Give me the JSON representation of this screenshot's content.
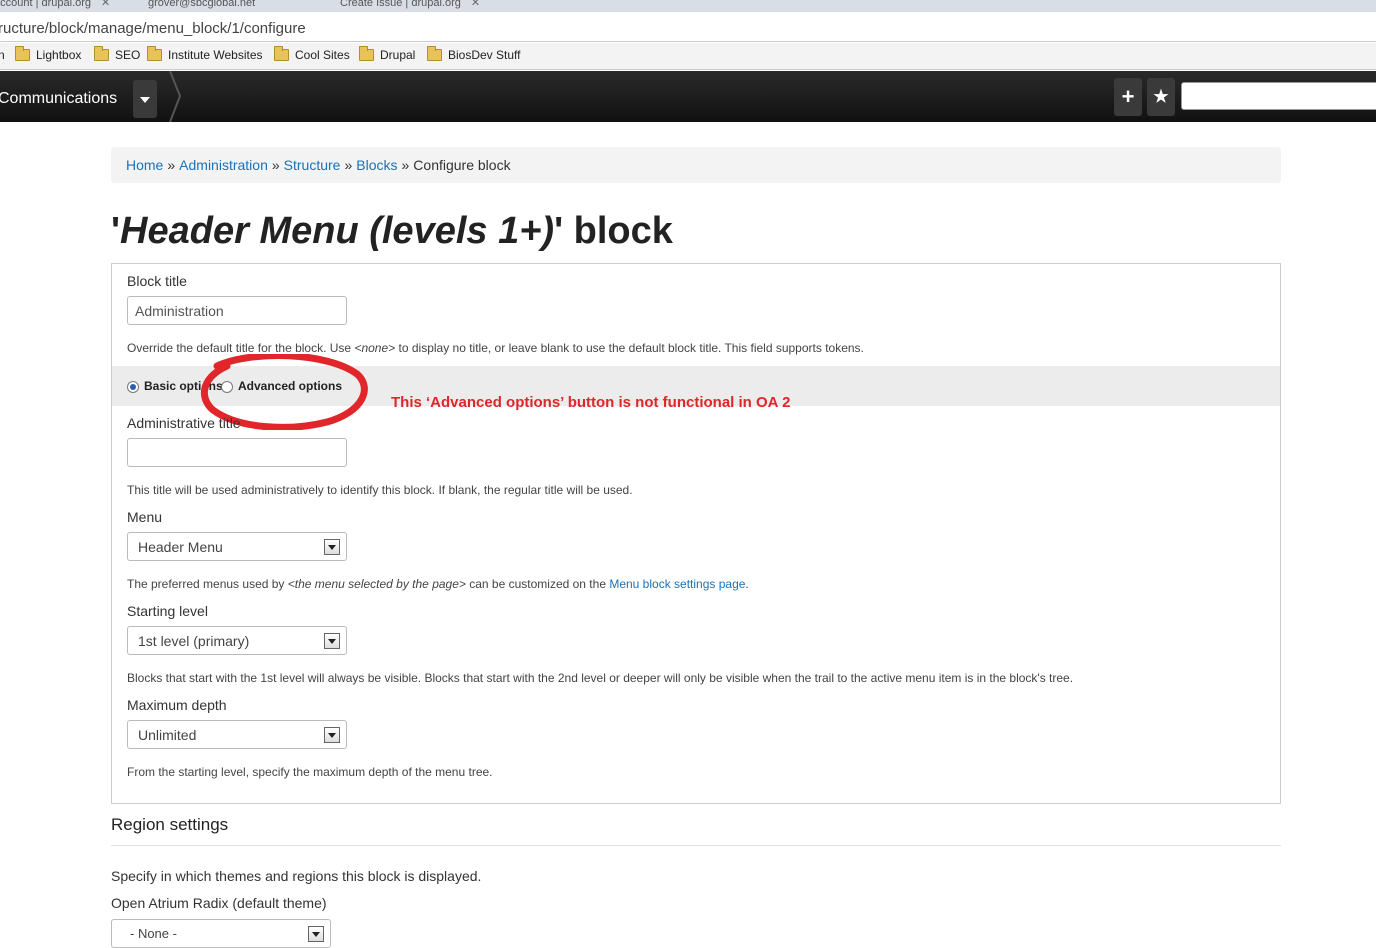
{
  "browser": {
    "tabs": [
      {
        "label": "account | drupal.org"
      },
      {
        "label": "grover@sbcglobal.net"
      },
      {
        "label": "Create Issue | drupal.org"
      }
    ],
    "tab_close": "✕",
    "url": "ructure/block/manage/menu_block/1/configure",
    "bookmarks": [
      "Lightbox",
      "SEO",
      "Institute Websites",
      "Cool Sites",
      "Drupal",
      "BiosDev Stuff"
    ]
  },
  "toolbar": {
    "site_name": "Communications",
    "add_icon": "+",
    "star_icon": "★"
  },
  "breadcrumb": {
    "items": [
      "Home",
      "Administration",
      "Structure",
      "Blocks"
    ],
    "separator": "»",
    "current": "Configure block"
  },
  "page": {
    "title_prefix": "'",
    "title_name": "Header Menu (levels 1+)",
    "title_suffix": "' block"
  },
  "form": {
    "block_title": {
      "label": "Block title",
      "value": "Administration",
      "desc_1": "Override the default title for the block. Use ",
      "desc_none": "<none>",
      "desc_2": " to display no title, or leave blank to use the default block title. This field supports tokens."
    },
    "options": {
      "basic": "Basic options",
      "advanced": "Advanced options"
    },
    "admin_title": {
      "label": "Administrative title",
      "value": "",
      "desc": "This title will be used administratively to identify this block. If blank, the regular title will be used."
    },
    "menu": {
      "label": "Menu",
      "value": "Header Menu",
      "desc_1": "The preferred menus used by ",
      "desc_em": "<the menu selected by the page>",
      "desc_2": " can be customized on the ",
      "desc_link": "Menu block settings page",
      "desc_3": "."
    },
    "starting_level": {
      "label": "Starting level",
      "value": "1st level (primary)",
      "desc": "Blocks that start with the 1st level will always be visible. Blocks that start with the 2nd level or deeper will only be visible when the trail to the active menu item is in the block's tree."
    },
    "max_depth": {
      "label": "Maximum depth",
      "value": "Unlimited",
      "desc": "From the starting level, specify the maximum depth of the menu tree."
    }
  },
  "annotation": {
    "text": "This ‘Advanced options’ button is not functional in OA 2",
    "color": "#e0262a"
  },
  "region": {
    "heading": "Region settings",
    "desc": "Specify in which themes and regions this block is displayed.",
    "theme_label": "Open Atrium Radix (default theme)",
    "theme_value": "- None -"
  }
}
